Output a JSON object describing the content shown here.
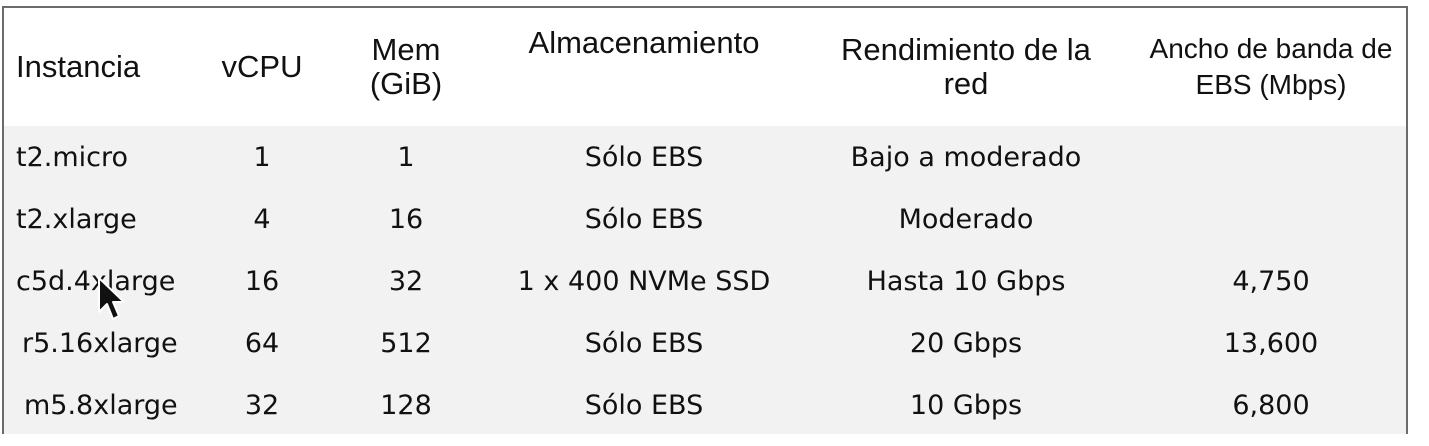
{
  "table": {
    "headers": [
      "Instancia",
      "vCPU",
      "Mem (GiB)",
      "Almacenamiento",
      "Rendimiento de la red",
      "Ancho de banda de EBS (Mbps)"
    ],
    "rows": [
      [
        "t2.micro",
        "1",
        "1",
        "Sólo EBS",
        "Bajo a moderado",
        ""
      ],
      [
        "t2.xlarge",
        "4",
        "16",
        "Sólo EBS",
        "Moderado",
        ""
      ],
      [
        "c5d.4xlarge",
        "16",
        "32",
        "1 x 400 NVMe SSD",
        "Hasta 10 Gbps",
        "4,750"
      ],
      [
        "r5.16xlarge",
        "64",
        "512",
        "Sólo EBS",
        "20 Gbps",
        "13,600"
      ],
      [
        "m5.8xlarge",
        "32",
        "128",
        "Sólo EBS",
        "10 Gbps",
        "6,800"
      ]
    ]
  },
  "colors": {
    "header_bg": "#ffffff",
    "row_bg": "#f2f2f2",
    "border": "#6b6b6b",
    "text": "#111111"
  },
  "icons": [
    "mouse-pointer-icon"
  ]
}
